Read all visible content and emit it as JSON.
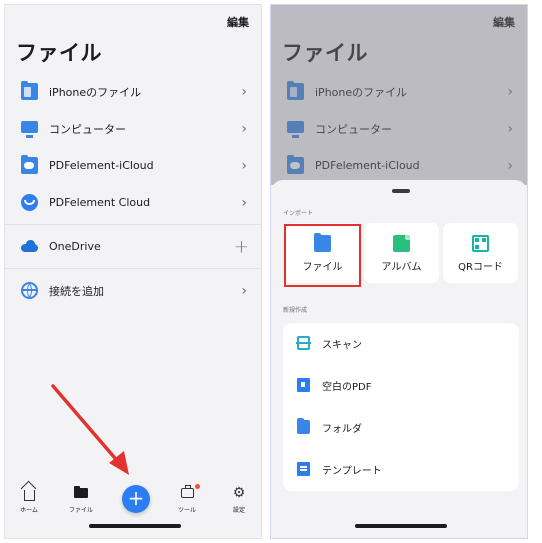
{
  "left_screen": {
    "edit_label": "編集",
    "title": "ファイル",
    "items": [
      {
        "label": "iPhoneのファイル",
        "icon": "folder-icon",
        "action": "chevron"
      },
      {
        "label": "コンピューター",
        "icon": "monitor-icon",
        "action": "chevron"
      },
      {
        "label": "PDFelement-iCloud",
        "icon": "cloud-folder-icon",
        "action": "chevron"
      },
      {
        "label": "PDFelement Cloud",
        "icon": "pdfelement-cloud-icon",
        "action": "chevron"
      },
      {
        "label": "OneDrive",
        "icon": "onedrive-icon",
        "action": "plus"
      },
      {
        "label": "接続を追加",
        "icon": "globe-icon",
        "action": "chevron"
      }
    ],
    "tabs": [
      {
        "label": "ホーム",
        "icon": "home-icon"
      },
      {
        "label": "ファイル",
        "icon": "folder-icon"
      },
      {
        "label": "ツール",
        "icon": "toolbox-icon",
        "badge": true
      },
      {
        "label": "設定",
        "icon": "gear-icon"
      }
    ],
    "fab_symbol": "+"
  },
  "right_screen": {
    "edit_label": "編集",
    "title": "ファイル",
    "background_items": [
      {
        "label": "iPhoneのファイル"
      },
      {
        "label": "コンピューター"
      },
      {
        "label": "PDFelement-iCloud"
      }
    ],
    "import_section": {
      "heading": "インポート",
      "options": [
        {
          "label": "ファイル",
          "icon": "folder-icon",
          "highlighted": true
        },
        {
          "label": "アルバム",
          "icon": "album-icon"
        },
        {
          "label": "QRコード",
          "icon": "qr-code-icon"
        }
      ]
    },
    "create_section": {
      "heading": "新規作成",
      "options": [
        {
          "label": "スキャン",
          "icon": "scan-icon"
        },
        {
          "label": "空白のPDF",
          "icon": "blank-pdf-icon"
        },
        {
          "label": "フォルダ",
          "icon": "folder-icon"
        },
        {
          "label": "テンプレート",
          "icon": "template-icon"
        }
      ]
    }
  },
  "colors": {
    "accent": "#2d7df2",
    "highlight": "#e3312f",
    "arrow": "#e3312f",
    "background": "#f3f3f6"
  }
}
